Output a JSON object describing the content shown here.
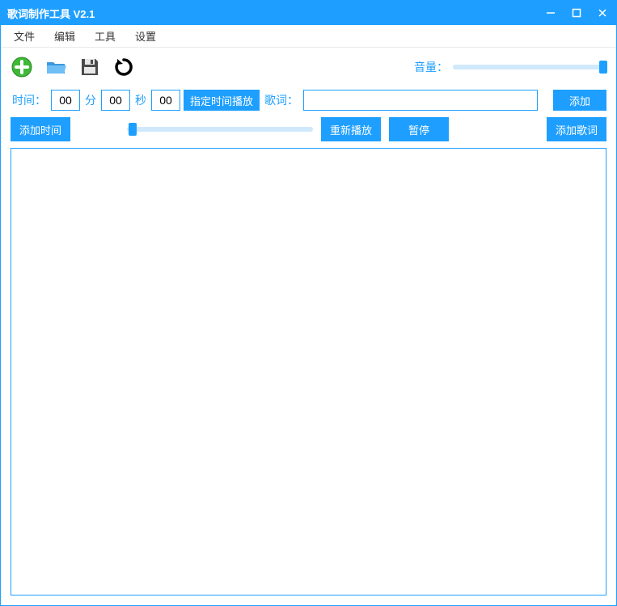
{
  "window": {
    "title": "歌词制作工具 V2.1"
  },
  "menu": {
    "file": "文件",
    "edit": "编辑",
    "tools": "工具",
    "settings": "设置"
  },
  "toolbar": {
    "volume_label": "音量：",
    "volume_value": 98
  },
  "time": {
    "label": "时间：",
    "t1": "00",
    "unit1": "分",
    "t2": "00",
    "unit2": "秒",
    "t3": "00",
    "play_at_label": "指定时间播放",
    "lyric_label": "歌词：",
    "lyric_value": "",
    "add_btn": "添加"
  },
  "actions": {
    "add_time": "添加时间",
    "replay": "重新播放",
    "pause": "暂停",
    "add_lyric": "添加歌词",
    "seek_value": 3
  },
  "lyrics_text": ""
}
